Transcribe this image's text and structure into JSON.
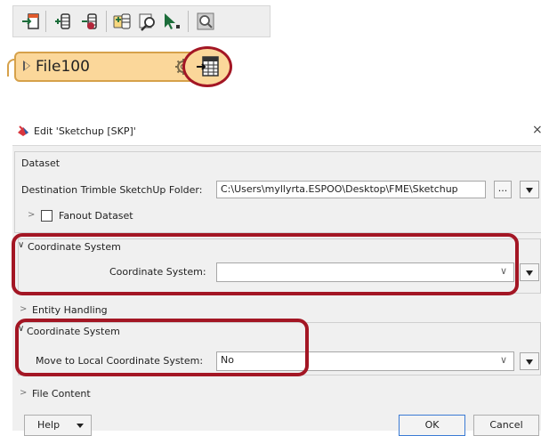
{
  "toolbar": {
    "icons": [
      "add-reader-icon",
      "add-writer-icon",
      "remove-writer-icon",
      "feature-types-icon",
      "inspect-icon",
      "run-selection-icon",
      "zoom-icon"
    ]
  },
  "transformer": {
    "name": "File100"
  },
  "dialog": {
    "title": "Edit 'Sketchup [SKP]'",
    "close": "×",
    "dataset_group": "Dataset",
    "dest_label": "Destination Trimble SketchUp Folder:",
    "dest_value": "C:\\Users\\myllyrta.ESPOO\\Desktop\\FME\\Sketchup",
    "browse_label": "...",
    "fanout_label": "Fanout Dataset",
    "coord_group": "Coordinate System",
    "coord_label": "Coordinate System:",
    "coord_value": "",
    "entity_group": "Entity Handling",
    "coord_group2": "Coordinate System",
    "move_label": "Move to Local Coordinate System:",
    "move_value": "No",
    "file_content_group": "File Content",
    "help_label": "Help",
    "ok_label": "OK",
    "cancel_label": "Cancel"
  },
  "colors": {
    "highlight": "#a31624",
    "node_fill": "#fbd79a",
    "node_border": "#d6a14a"
  }
}
